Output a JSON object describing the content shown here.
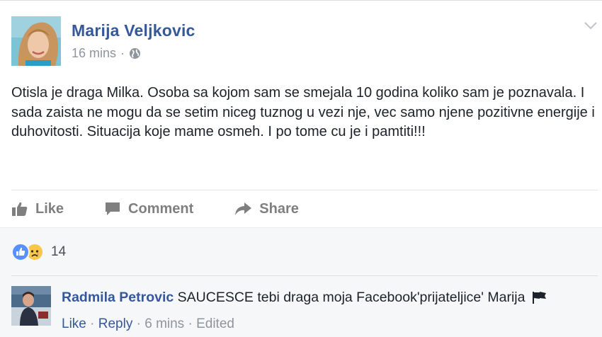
{
  "post": {
    "author": "Marija Veljkovic",
    "time": "16 mins",
    "separator": "·",
    "privacy_icon": "globe-icon",
    "menu_icon": "chevron-down-icon",
    "text": "Otisla je draga Milka. Osoba sa kojom sam se smejala 10 godina koliko sam je poznavala. I sada zaista ne mogu da se setim niceg tuznog u vezi nje, vec samo njene pozitivne energije i duhovitosti. Situacija koje mame osmeh. I po tome cu je i pamtiti!!!"
  },
  "actions": {
    "like": "Like",
    "comment": "Comment",
    "share": "Share"
  },
  "reactions": {
    "types": [
      "like",
      "sad"
    ],
    "count": "14"
  },
  "comment": {
    "author": "Radmila Petrovic",
    "text": "SAUCESCE tebi draga moja Facebook'prijateljice' Marija",
    "like": "Like",
    "reply": "Reply",
    "sep": "·",
    "time": "6 mins",
    "edited": "Edited"
  },
  "colors": {
    "link": "#365899",
    "muted": "#90949c",
    "action": "#7f7f7f",
    "like_reaction": "#5890ff",
    "sad_reaction": "#f7c64b"
  }
}
